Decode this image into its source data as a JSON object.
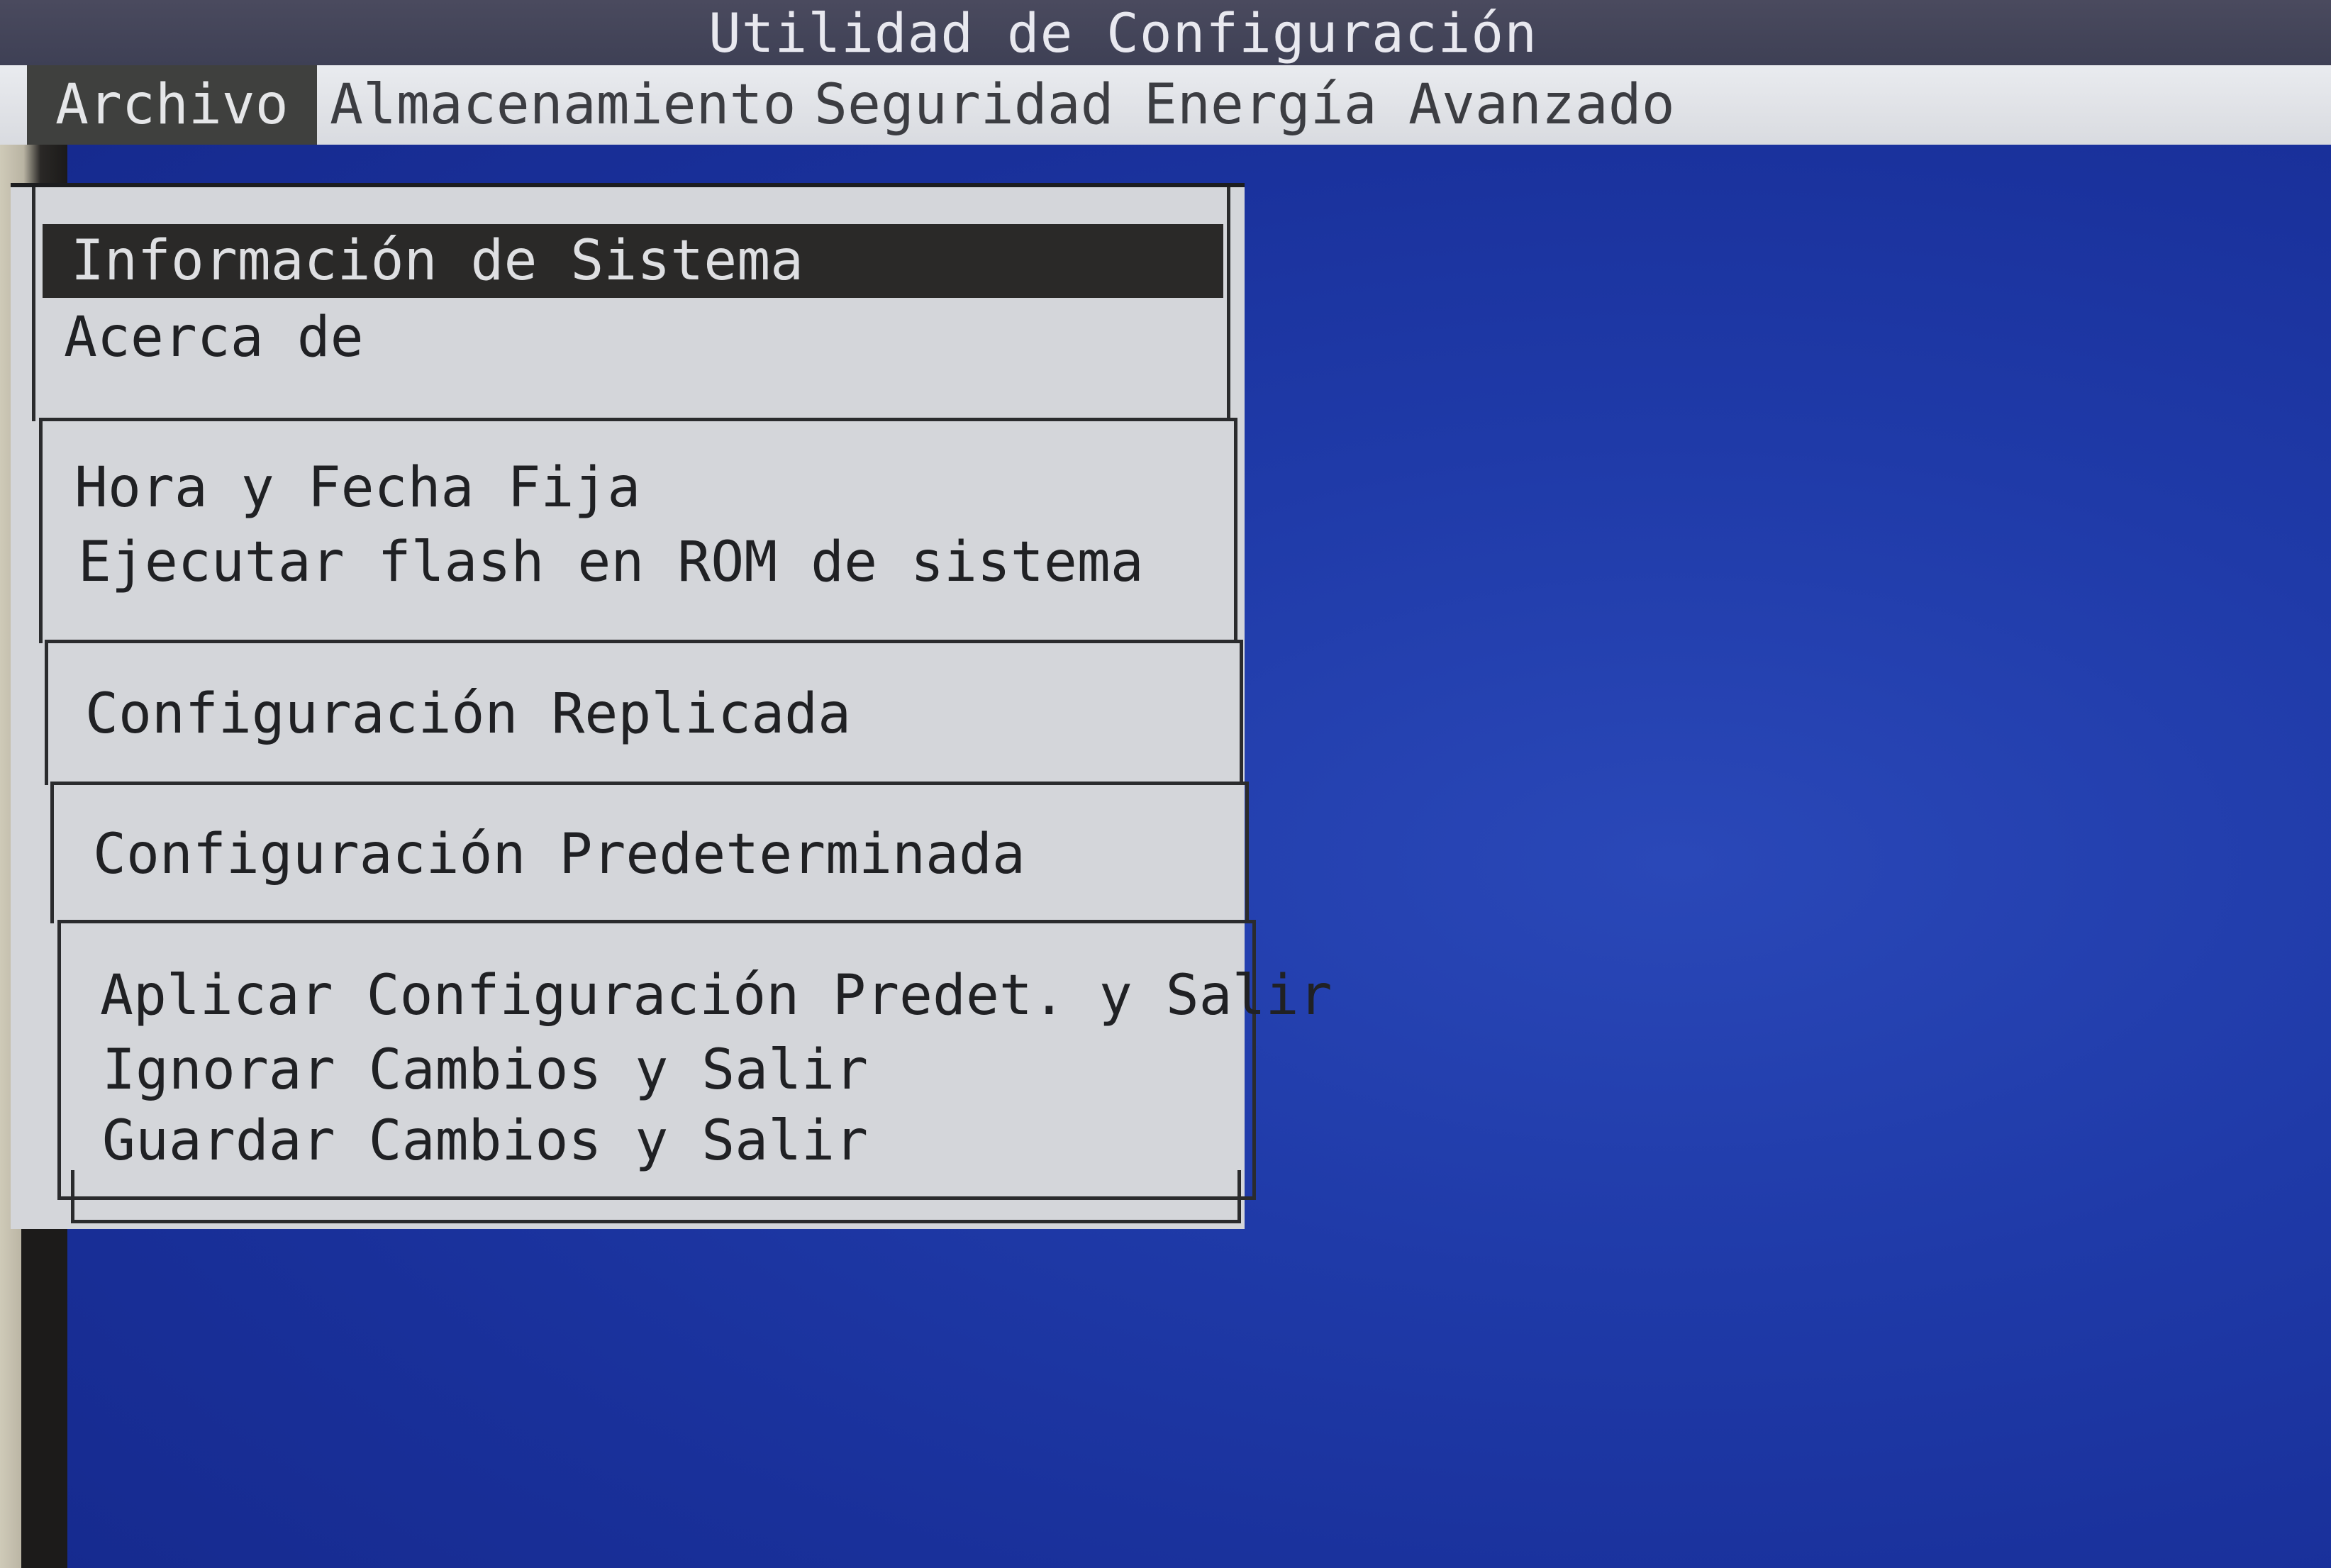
{
  "window": {
    "title": "Utilidad de Configuración"
  },
  "menubar": {
    "items": [
      {
        "label": "Archivo",
        "active": true
      },
      {
        "label": "Almacenamiento",
        "active": false
      },
      {
        "label": "Seguridad",
        "active": false
      },
      {
        "label": "Energía",
        "active": false
      },
      {
        "label": "Avanzado",
        "active": false
      }
    ]
  },
  "dropdown": {
    "groups": [
      {
        "items": [
          {
            "label": "Información de Sistema",
            "selected": true
          },
          {
            "label": "Acerca de",
            "selected": false
          }
        ]
      },
      {
        "items": [
          {
            "label": "Hora y Fecha Fija",
            "selected": false
          },
          {
            "label": "Ejecutar flash en ROM de sistema",
            "selected": false
          }
        ]
      },
      {
        "items": [
          {
            "label": "Configuración Replicada",
            "selected": false
          }
        ]
      },
      {
        "items": [
          {
            "label": "Configuración Predeterminada",
            "selected": false
          }
        ]
      },
      {
        "items": [
          {
            "label": "Aplicar Configuración Predet. y Salir",
            "selected": false
          },
          {
            "label": "Ignorar Cambios y Salir",
            "selected": false
          },
          {
            "label": "Guardar Cambios y Salir",
            "selected": false
          }
        ]
      }
    ]
  },
  "colors": {
    "background": "#1f3aa8",
    "titlebar": "#3e4055",
    "menubar": "#e0e2e6",
    "highlight": "#2a2928"
  }
}
